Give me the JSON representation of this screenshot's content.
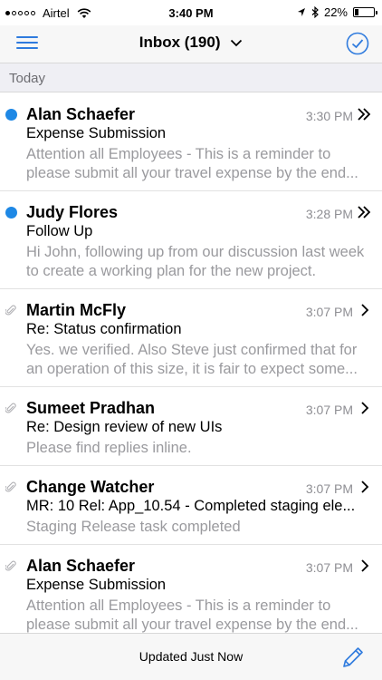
{
  "status_bar": {
    "carrier": "Airtel",
    "time": "3:40 PM",
    "battery": "22%",
    "battery_level": 0.22
  },
  "nav": {
    "title": "Inbox (190)",
    "menu_icon": "hamburger-menu-icon",
    "select_icon": "checkmark-circle-icon"
  },
  "section": {
    "label": "Today"
  },
  "colors": {
    "accent": "#2f7bde",
    "unread": "#1e88e5"
  },
  "emails": [
    {
      "sender": "Alan Schaefer",
      "time": "3:30 PM",
      "subject": "Expense Submission",
      "preview": "Attention all Employees - This is a reminder to please submit all your travel expense by the end...",
      "unread": true,
      "attachment": false,
      "thread": true
    },
    {
      "sender": "Judy Flores",
      "time": "3:28 PM",
      "subject": "Follow Up",
      "preview": "Hi John, following up from our discussion last week to create a working plan for the new project.",
      "unread": true,
      "attachment": false,
      "thread": true
    },
    {
      "sender": "Martin McFly",
      "time": "3:07 PM",
      "subject": "Re: Status confirmation",
      "preview": "Yes. we verified. Also Steve just confirmed that for an operation of this size, it is fair to expect some...",
      "unread": false,
      "attachment": true,
      "thread": false
    },
    {
      "sender": "Sumeet Pradhan",
      "time": "3:07 PM",
      "subject": "Re: Design review of new UIs",
      "preview": "Please find replies inline.",
      "unread": false,
      "attachment": true,
      "thread": false
    },
    {
      "sender": "Change Watcher",
      "time": "3:07 PM",
      "subject": "MR: 10 Rel: App_10.54 - Completed staging ele...",
      "preview": "Staging Release task completed",
      "unread": false,
      "attachment": true,
      "thread": false
    },
    {
      "sender": "Alan Schaefer",
      "time": "3:07 PM",
      "subject": "Expense Submission",
      "preview": "Attention all Employees - This is a reminder to please submit all your travel expense by the end...",
      "unread": false,
      "attachment": true,
      "thread": false
    }
  ],
  "bottom_bar": {
    "status": "Updated Just Now",
    "compose_icon": "compose-pencil-icon"
  }
}
